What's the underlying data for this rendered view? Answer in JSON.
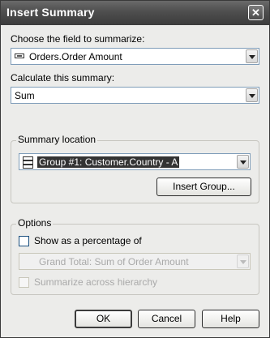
{
  "dialog": {
    "title": "Insert Summary",
    "close_glyph": "✕",
    "field_label": "Choose the field to summarize:",
    "field_value": "Orders.Order Amount",
    "calc_label": "Calculate this summary:",
    "calc_value": "Sum",
    "location": {
      "legend": "Summary location",
      "group_value": "Group #1: Customer.Country - A",
      "insert_group_button": "Insert Group..."
    },
    "options": {
      "legend": "Options",
      "show_percentage_label": "Show as a percentage of",
      "show_percentage_checked": false,
      "percentage_of_value": "Grand Total: Sum of Order Amount",
      "summarize_across_label": "Summarize across hierarchy",
      "summarize_across_checked": false
    },
    "buttons": {
      "ok": "OK",
      "cancel": "Cancel",
      "help": "Help"
    }
  }
}
